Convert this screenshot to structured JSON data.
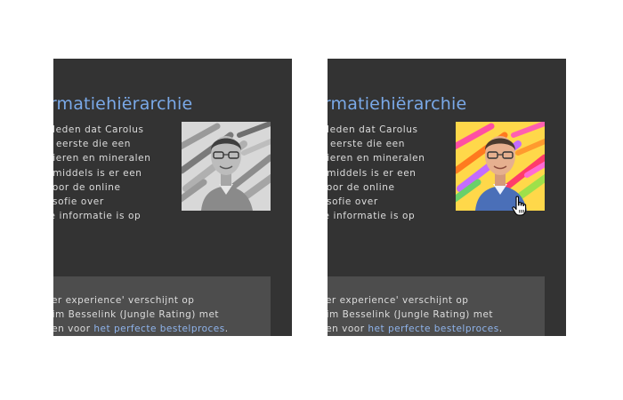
{
  "heading": "ormatiehiërarchie",
  "paragraph_lines": [
    "eleden dat Carolus",
    "e eerste die een",
    " dieren en mineralen",
    "nmiddels is er een",
    " voor de online",
    "osofie over",
    "le informatie is op"
  ],
  "box": {
    "line1": "ser experience' verschijnt op",
    "line2": "Tim Besselink (Jungle Rating) met",
    "line3_prefix": "ken voor ",
    "link": "het perfecte bestelproces",
    "line3_suffix": "."
  },
  "states": {
    "left": "grayscale",
    "right": "color-hover"
  },
  "icons": {
    "cursor": "hand-pointer-icon"
  },
  "colors": {
    "panel_background": "#333333",
    "box_background": "#4d4d4d",
    "heading": "#7aa9e8",
    "link": "#8fb4ec",
    "text": "#dddddd"
  }
}
